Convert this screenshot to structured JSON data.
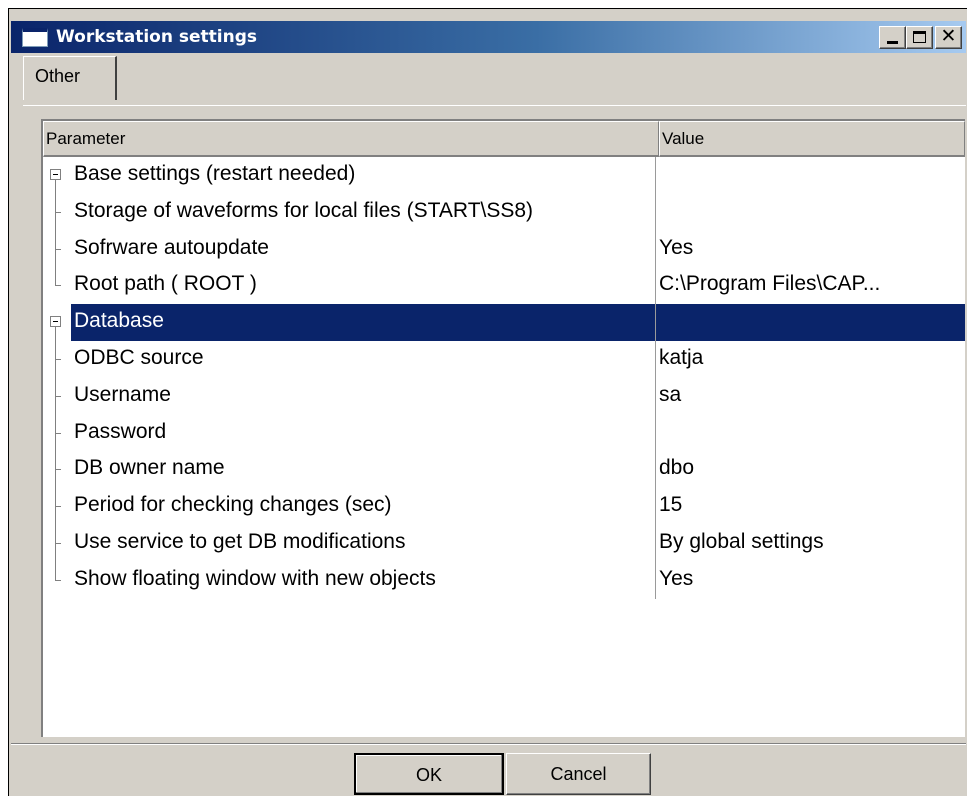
{
  "window": {
    "title": "Workstation settings",
    "controls": [
      "minimize-icon",
      "maximize-icon",
      "close-icon"
    ],
    "close_glyph": "✕"
  },
  "tabs": [
    {
      "label": "Other",
      "active": true
    }
  ],
  "grid": {
    "columns": {
      "parameter": "Parameter",
      "value": "Value"
    },
    "rows": [
      {
        "label": "Base settings (restart needed)",
        "value": "",
        "type": "group",
        "expanded": true
      },
      {
        "label": "Storage of waveforms for local files (START\\SS8)",
        "value": "",
        "type": "item"
      },
      {
        "label": "Sofrware autoupdate",
        "value": "Yes",
        "type": "item"
      },
      {
        "label": "Root path ( ROOT )",
        "value": "C:\\Program Files\\CAP...",
        "type": "item-last"
      },
      {
        "label": "Database",
        "value": "",
        "type": "group",
        "expanded": true,
        "selected": true
      },
      {
        "label": "ODBC source",
        "value": "katja",
        "type": "item"
      },
      {
        "label": "Username",
        "value": "sa",
        "type": "item"
      },
      {
        "label": "Password",
        "value": "",
        "type": "item"
      },
      {
        "label": "DB owner name",
        "value": "dbo",
        "type": "item"
      },
      {
        "label": "Period for checking changes (sec)",
        "value": "15",
        "type": "item"
      },
      {
        "label": "Use service to get DB modifications",
        "value": "By global settings",
        "type": "item"
      },
      {
        "label": "Show floating window with new objects",
        "value": "Yes",
        "type": "item-last"
      }
    ]
  },
  "buttons": {
    "ok": "OK",
    "cancel": "Cancel"
  },
  "colors": {
    "title_gradient_start": "#0a246a",
    "selection": "#0a246a",
    "face": "#d4d0c8"
  }
}
